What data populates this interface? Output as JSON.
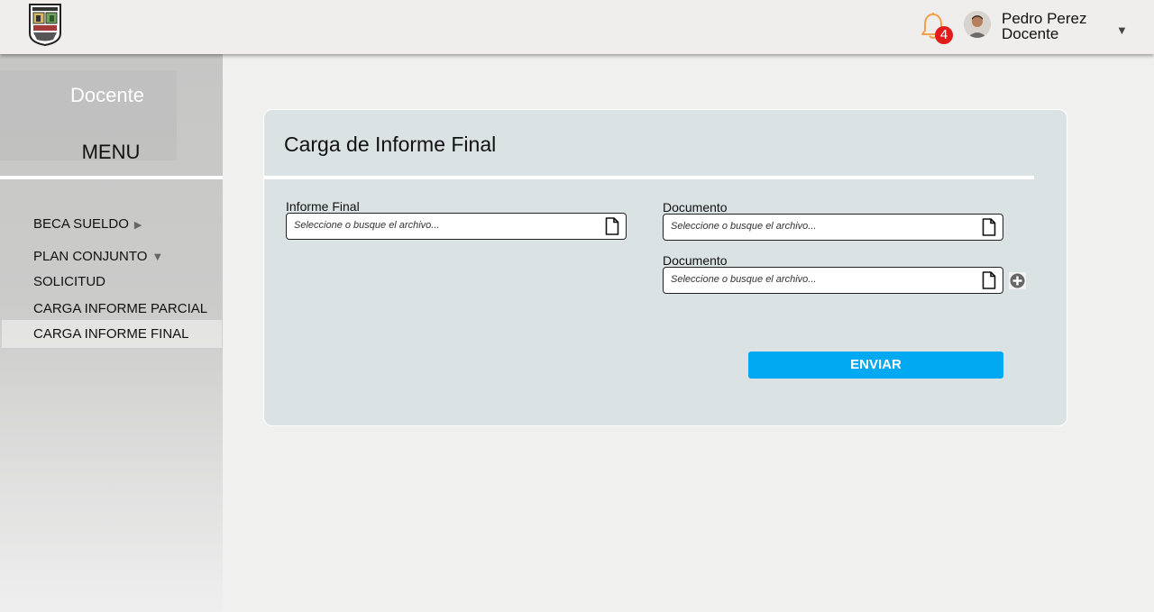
{
  "header": {
    "notifications_count": "4",
    "user": {
      "name": "Pedro Perez",
      "role": "Docente"
    },
    "icons": {
      "logo": "university-shield-logo",
      "bell": "bell-icon",
      "avatar": "user-avatar",
      "caret": "chevron-down-icon"
    },
    "accent_color": "#f5a04a",
    "badge_color": "#e31b1b"
  },
  "sidebar": {
    "role": "Docente",
    "menu_title": "MENU",
    "items": [
      {
        "label": "BECA SUELDO",
        "icon": "caret-right-icon"
      },
      {
        "label": "PLAN CONJUNTO",
        "icon": "caret-down-icon"
      },
      {
        "label": "SOLICITUD"
      },
      {
        "label": "CARGA INFORME PARCIAL"
      },
      {
        "label": "CARGA INFORME FINAL",
        "active": true
      }
    ]
  },
  "form": {
    "title": "Carga de Informe Final",
    "fields": [
      {
        "label": "Informe Final",
        "placeholder": "Seleccione o busque el archivo..."
      },
      {
        "label": "Documento",
        "placeholder": "Seleccione o busque el archivo..."
      },
      {
        "label": "Documento",
        "placeholder": "Seleccione o busque el archivo..."
      }
    ],
    "submit_label": "ENVIAR",
    "submit_color": "#00a9f1"
  }
}
